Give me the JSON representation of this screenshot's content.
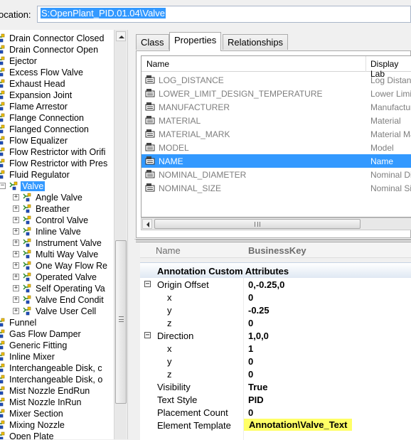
{
  "location": {
    "label": "ocation:",
    "value": "S:OpenPlant_PID.01.04\\Valve"
  },
  "tree": {
    "items": [
      {
        "label": "Drain Connector Closed",
        "level": 0
      },
      {
        "label": "Drain Connector Open",
        "level": 0
      },
      {
        "label": "Ejector",
        "level": 0
      },
      {
        "label": "Excess Flow Valve",
        "level": 0
      },
      {
        "label": "Exhaust Head",
        "level": 0
      },
      {
        "label": "Expansion Joint",
        "level": 0
      },
      {
        "label": "Flame Arrestor",
        "level": 0
      },
      {
        "label": "Flange Connection",
        "level": 0
      },
      {
        "label": "Flanged Connection",
        "level": 0
      },
      {
        "label": "Flow Equalizer",
        "level": 0
      },
      {
        "label": "Flow Restrictor with Orifi",
        "level": 0
      },
      {
        "label": "Flow Restrictor with Pres",
        "level": 0
      },
      {
        "label": "Fluid Regulator",
        "level": 0
      },
      {
        "label": "Valve",
        "level": 0,
        "expanded": true,
        "selected": true
      },
      {
        "label": "Angle Valve",
        "level": 1
      },
      {
        "label": "Breather",
        "level": 1
      },
      {
        "label": "Control Valve",
        "level": 1
      },
      {
        "label": "Inline Valve",
        "level": 1
      },
      {
        "label": "Instrument Valve",
        "level": 1
      },
      {
        "label": "Multi Way Valve",
        "level": 1
      },
      {
        "label": "One Way Flow Re",
        "level": 1
      },
      {
        "label": "Operated Valve",
        "level": 1
      },
      {
        "label": "Self Operating Va",
        "level": 1
      },
      {
        "label": "Valve End Condit",
        "level": 1
      },
      {
        "label": "Valve User Cell",
        "level": 1
      },
      {
        "label": "Funnel",
        "level": 0
      },
      {
        "label": "Gas Flow Damper",
        "level": 0
      },
      {
        "label": "Generic Fitting",
        "level": 0
      },
      {
        "label": "Inline Mixer",
        "level": 0
      },
      {
        "label": "Interchangeable Disk, c",
        "level": 0
      },
      {
        "label": "Interchangeable Disk, o",
        "level": 0
      },
      {
        "label": "Mist Nozzle EndRun",
        "level": 0
      },
      {
        "label": "Mist Nozzle InRun",
        "level": 0
      },
      {
        "label": "Mixer Section",
        "level": 0
      },
      {
        "label": "Mixing Nozzle",
        "level": 0
      },
      {
        "label": "Open Plate",
        "level": 0
      }
    ]
  },
  "tabs": [
    {
      "label": "Class",
      "active": false
    },
    {
      "label": "Properties",
      "active": true
    },
    {
      "label": "Relationships",
      "active": false
    }
  ],
  "grid": {
    "columns": [
      "Name",
      "Display Lab"
    ],
    "rows": [
      {
        "name": "LOG_DISTANCE",
        "display": "Log Distanc"
      },
      {
        "name": "LOWER_LIMIT_DESIGN_TEMPERATURE",
        "display": "Lower Limi"
      },
      {
        "name": "MANUFACTURER",
        "display": "Manufactur"
      },
      {
        "name": "MATERIAL",
        "display": "Material"
      },
      {
        "name": "MATERIAL_MARK",
        "display": "Material Ma"
      },
      {
        "name": "MODEL",
        "display": "Model"
      },
      {
        "name": "NAME",
        "display": "Name",
        "selected": true
      },
      {
        "name": "NOMINAL_DIAMETER",
        "display": "Nominal Di"
      },
      {
        "name": "NOMINAL_SIZE",
        "display": "Nominal Si"
      }
    ]
  },
  "business_key": {
    "name": "Name",
    "value": "BusinessKey"
  },
  "annotation": {
    "category": "Annotation Custom Attributes",
    "rows": [
      {
        "name": "Origin Offset",
        "value": "0,-0.25,0",
        "expander": "−",
        "indent": 0
      },
      {
        "name": "x",
        "value": "0",
        "indent": 1
      },
      {
        "name": "y",
        "value": "-0.25",
        "indent": 1
      },
      {
        "name": "z",
        "value": "0",
        "indent": 1
      },
      {
        "name": "Direction",
        "value": "1,0,0",
        "expander": "−",
        "indent": 0
      },
      {
        "name": "x",
        "value": "1",
        "indent": 1
      },
      {
        "name": "y",
        "value": "0",
        "indent": 1
      },
      {
        "name": "z",
        "value": "0",
        "indent": 1
      },
      {
        "name": "Visibility",
        "value": "True",
        "indent": 0
      },
      {
        "name": "Text Style",
        "value": "PID",
        "indent": 0
      },
      {
        "name": "Placement Count",
        "value": "0",
        "indent": 0
      },
      {
        "name": "Element Template",
        "value": "Annotation\\Valve_Text",
        "indent": 0,
        "highlight": true
      }
    ]
  },
  "colors": {
    "selection": "#3399ff",
    "highlight": "#ffff66"
  },
  "icons": {
    "tree_item": "class-node-icon",
    "grid_item": "property-icon"
  }
}
